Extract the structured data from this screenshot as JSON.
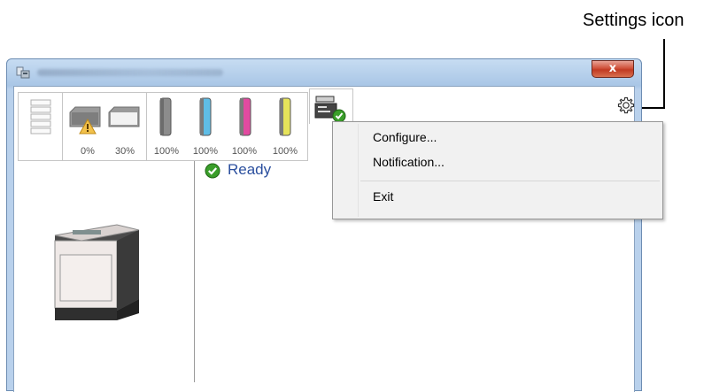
{
  "annotation": {
    "label": "Settings icon"
  },
  "window": {
    "close_glyph": "x"
  },
  "toolbar": {
    "waste": [
      {
        "percent": "0%",
        "warning": true
      },
      {
        "percent": "30%"
      }
    ],
    "toner": [
      {
        "color": "#8c8c8c",
        "percent": "100%"
      },
      {
        "color": "#5fbde6",
        "percent": "100%"
      },
      {
        "color": "#e24aa0",
        "percent": "100%"
      },
      {
        "color": "#e6e35a",
        "percent": "100%"
      }
    ]
  },
  "status": {
    "text": "Ready",
    "icon": "green-check-icon"
  },
  "context_menu": {
    "items": [
      {
        "label": "Configure..."
      },
      {
        "label": "Notification..."
      },
      {
        "label": "Exit"
      }
    ]
  },
  "icons": {
    "settings": "gear-icon",
    "status_tab": "printer-status-icon",
    "paper": "paper-stack-icon"
  }
}
